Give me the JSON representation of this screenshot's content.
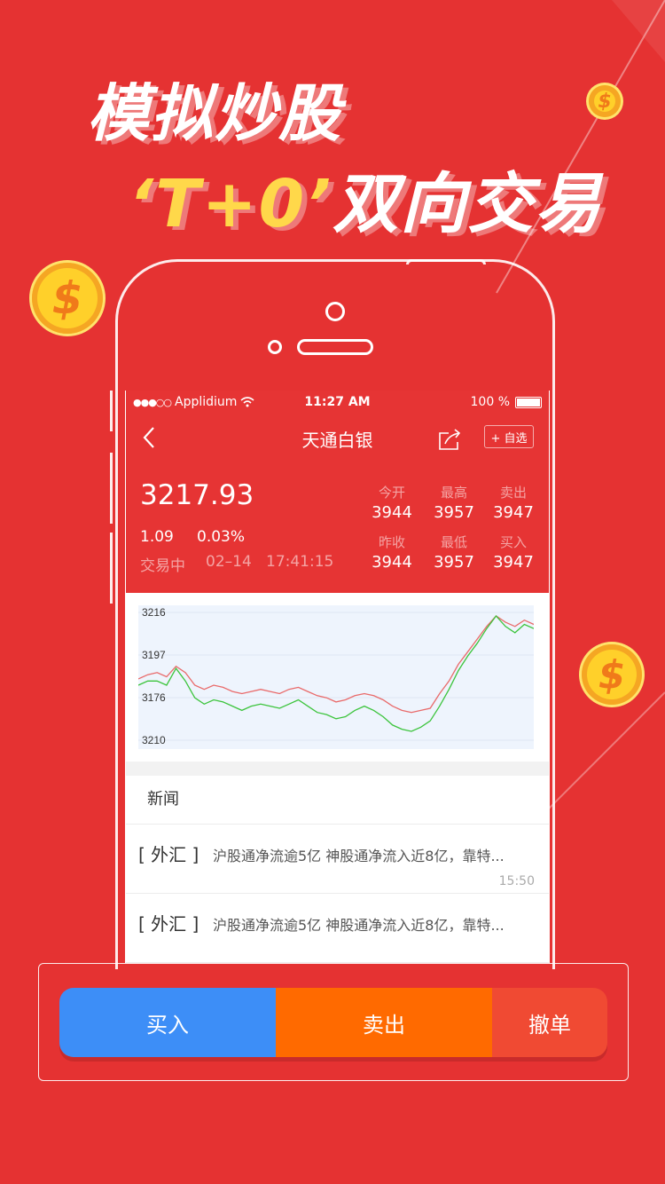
{
  "promo": {
    "headline_line1": "模拟炒股",
    "headline_line2_quote": "‘T+0’",
    "headline_line2_text": "双向交易",
    "coin_symbol": "$"
  },
  "status_bar": {
    "signal": "●●●○○",
    "carrier": "Applidium",
    "time": "11:27 AM",
    "battery": "100 %"
  },
  "nav": {
    "title": "天通白银",
    "favorite_label": "+ 自选"
  },
  "quote": {
    "price": "3217.93",
    "change_abs": "1.09",
    "change_pct": "0.03%",
    "status": "交易中",
    "date": "02–14",
    "time": "17:41:15",
    "cells": [
      {
        "label": "今开",
        "value": "3944"
      },
      {
        "label": "最高",
        "value": "3957"
      },
      {
        "label": "卖出",
        "value": "3947"
      },
      {
        "label": "昨收",
        "value": "3944"
      },
      {
        "label": "最低",
        "value": "3957"
      },
      {
        "label": "买入",
        "value": "3947"
      }
    ]
  },
  "chart_data": {
    "type": "line",
    "y_tick_labels": [
      "3216",
      "3197",
      "3176",
      "3210"
    ],
    "grid": true,
    "series": [
      {
        "color": "#e96a6a",
        "values": [
          3183,
          3185,
          3186,
          3184,
          3189,
          3186,
          3180,
          3178,
          3180,
          3179,
          3177,
          3176,
          3177,
          3178,
          3177,
          3176,
          3178,
          3179,
          3177,
          3175,
          3174,
          3172,
          3173,
          3175,
          3176,
          3175,
          3173,
          3170,
          3168,
          3167,
          3168,
          3169,
          3176,
          3182,
          3190,
          3196,
          3202,
          3208,
          3213,
          3210,
          3208,
          3211,
          3209
        ]
      },
      {
        "color": "#3cc43c",
        "values": [
          3180,
          3182,
          3182,
          3180,
          3188,
          3182,
          3174,
          3171,
          3173,
          3172,
          3170,
          3168,
          3170,
          3171,
          3170,
          3169,
          3171,
          3173,
          3170,
          3167,
          3166,
          3164,
          3165,
          3168,
          3170,
          3168,
          3165,
          3161,
          3159,
          3158,
          3160,
          3163,
          3170,
          3178,
          3187,
          3194,
          3200,
          3207,
          3213,
          3208,
          3205,
          3209,
          3207
        ]
      }
    ]
  },
  "news": {
    "header": "新闻",
    "items": [
      {
        "tag": "[ 外汇 ]",
        "text": "沪股通净流逾5亿 神股通净流入近8亿，靠特...",
        "time": "15:50"
      },
      {
        "tag": "[ 外汇 ]",
        "text": "沪股通净流逾5亿 神股通净流入近8亿，靠特...",
        "time": ""
      }
    ]
  },
  "actions": {
    "buy": "买入",
    "sell": "卖出",
    "cancel": "撤单"
  },
  "colors": {
    "background": "#e53232",
    "buy": "#3d8ef7",
    "sell": "#ff6a00",
    "cancel": "#f04a33"
  }
}
